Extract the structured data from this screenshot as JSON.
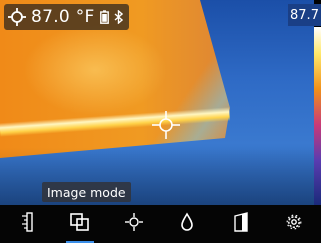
{
  "status": {
    "spot_temperature": "87.0 °F",
    "battery_icon": "battery-icon",
    "bluetooth_icon": "bluetooth-icon",
    "max_temperature": "87.7"
  },
  "tooltip": {
    "text": "Image mode"
  },
  "toolbar": {
    "active_index": 1,
    "items": [
      {
        "icon": "emissivity-icon",
        "selected": false
      },
      {
        "icon": "image-mode-icon",
        "selected": true
      },
      {
        "icon": "spot-target-icon",
        "selected": false
      },
      {
        "icon": "humidity-drop-icon",
        "selected": false
      },
      {
        "icon": "palette-icon",
        "selected": false
      },
      {
        "icon": "settings-gear-icon",
        "selected": false
      }
    ]
  },
  "colors": {
    "scale_top": "#ffffff",
    "scale_bottom": "#1a2a7a",
    "hot": "#f0901a",
    "cold": "#2f6bc6"
  }
}
